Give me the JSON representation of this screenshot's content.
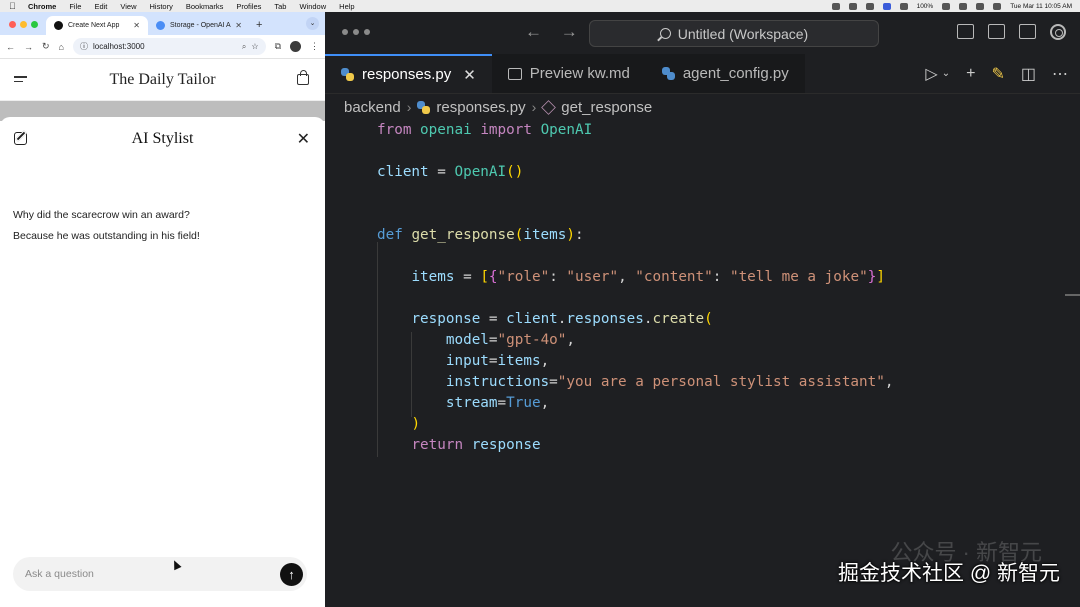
{
  "menubar": {
    "app": "Chrome",
    "items": [
      "File",
      "Edit",
      "View",
      "History",
      "Bookmarks",
      "Profiles",
      "Tab",
      "Window",
      "Help"
    ],
    "battery": "100%",
    "clock": "Tue Mar 11  10:05 AM"
  },
  "chrome": {
    "tabs": [
      {
        "title": "Create Next App",
        "active": true
      },
      {
        "title": "Storage - OpenAI A",
        "active": false
      }
    ],
    "url": "localhost:3000",
    "site_brand": "The Daily Tailor"
  },
  "stylist": {
    "title": "AI Stylist",
    "messages": [
      "Why did the scarecrow win an award?",
      "Because he was outstanding in his field!"
    ],
    "input_placeholder": "Ask a question"
  },
  "vscode": {
    "command_center": "Untitled (Workspace)",
    "tabs": [
      {
        "label": "responses.py",
        "active": true,
        "icon": "python-icon"
      },
      {
        "label": "Preview kw.md",
        "active": false,
        "icon": "markdown-preview-icon"
      },
      {
        "label": "agent_config.py",
        "active": false,
        "icon": "python-icon"
      }
    ],
    "breadcrumb": [
      "backend",
      "responses.py",
      "get_response"
    ],
    "code_lines": [
      "from openai import OpenAI",
      "",
      "client = OpenAI()",
      "",
      "",
      "def get_response(items):",
      "",
      "    items = [{\"role\": \"user\", \"content\": \"tell me a joke\"}]",
      "",
      "    response = client.responses.create(",
      "        model=\"gpt-4o\",",
      "        input=items,",
      "        instructions=\"you are a personal stylist assistant\",",
      "        stream=True,",
      "    )",
      "    return response"
    ]
  },
  "watermark": {
    "main": "掘金技术社区 @ 新智元",
    "faded": "公众号 · 新智元"
  }
}
